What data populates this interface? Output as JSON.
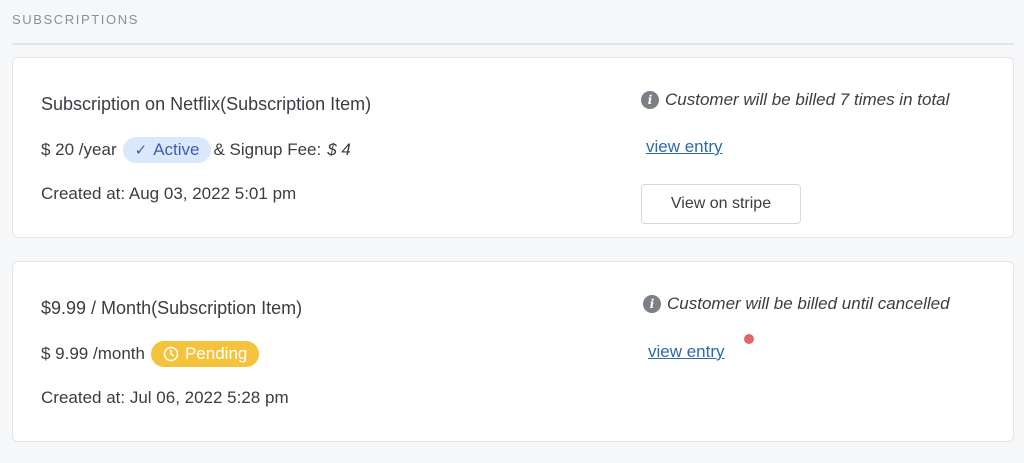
{
  "section": {
    "title": "SUBSCRIPTIONS"
  },
  "subscriptions": [
    {
      "title": "Subscription on Netflix(Subscription Item)",
      "price": "$ 20 /year",
      "status": {
        "label": "Active",
        "icon": "check-icon",
        "color": "#3c5fa8",
        "bg": "#dbe8fb"
      },
      "signup_fee_label": "& Signup Fee:",
      "signup_fee_value": "$ 4",
      "created": "Created at: Aug 03, 2022 5:01 pm",
      "billing_note": "Customer will be billed 7 times in total",
      "view_entry_label": "view entry",
      "stripe_button_label": "View on stripe"
    },
    {
      "title": "$9.99 / Month(Subscription Item)",
      "price": "$ 9.99 /month",
      "status": {
        "label": "Pending",
        "icon": "clock-icon",
        "color": "#ffffff",
        "bg": "#f5c33b"
      },
      "created": "Created at: Jul 06, 2022 5:28 pm",
      "billing_note": "Customer will be billed until cancelled",
      "view_entry_label": "view entry"
    }
  ],
  "colors": {
    "link": "#2d6aa6",
    "notification_dot": "#e06767"
  }
}
